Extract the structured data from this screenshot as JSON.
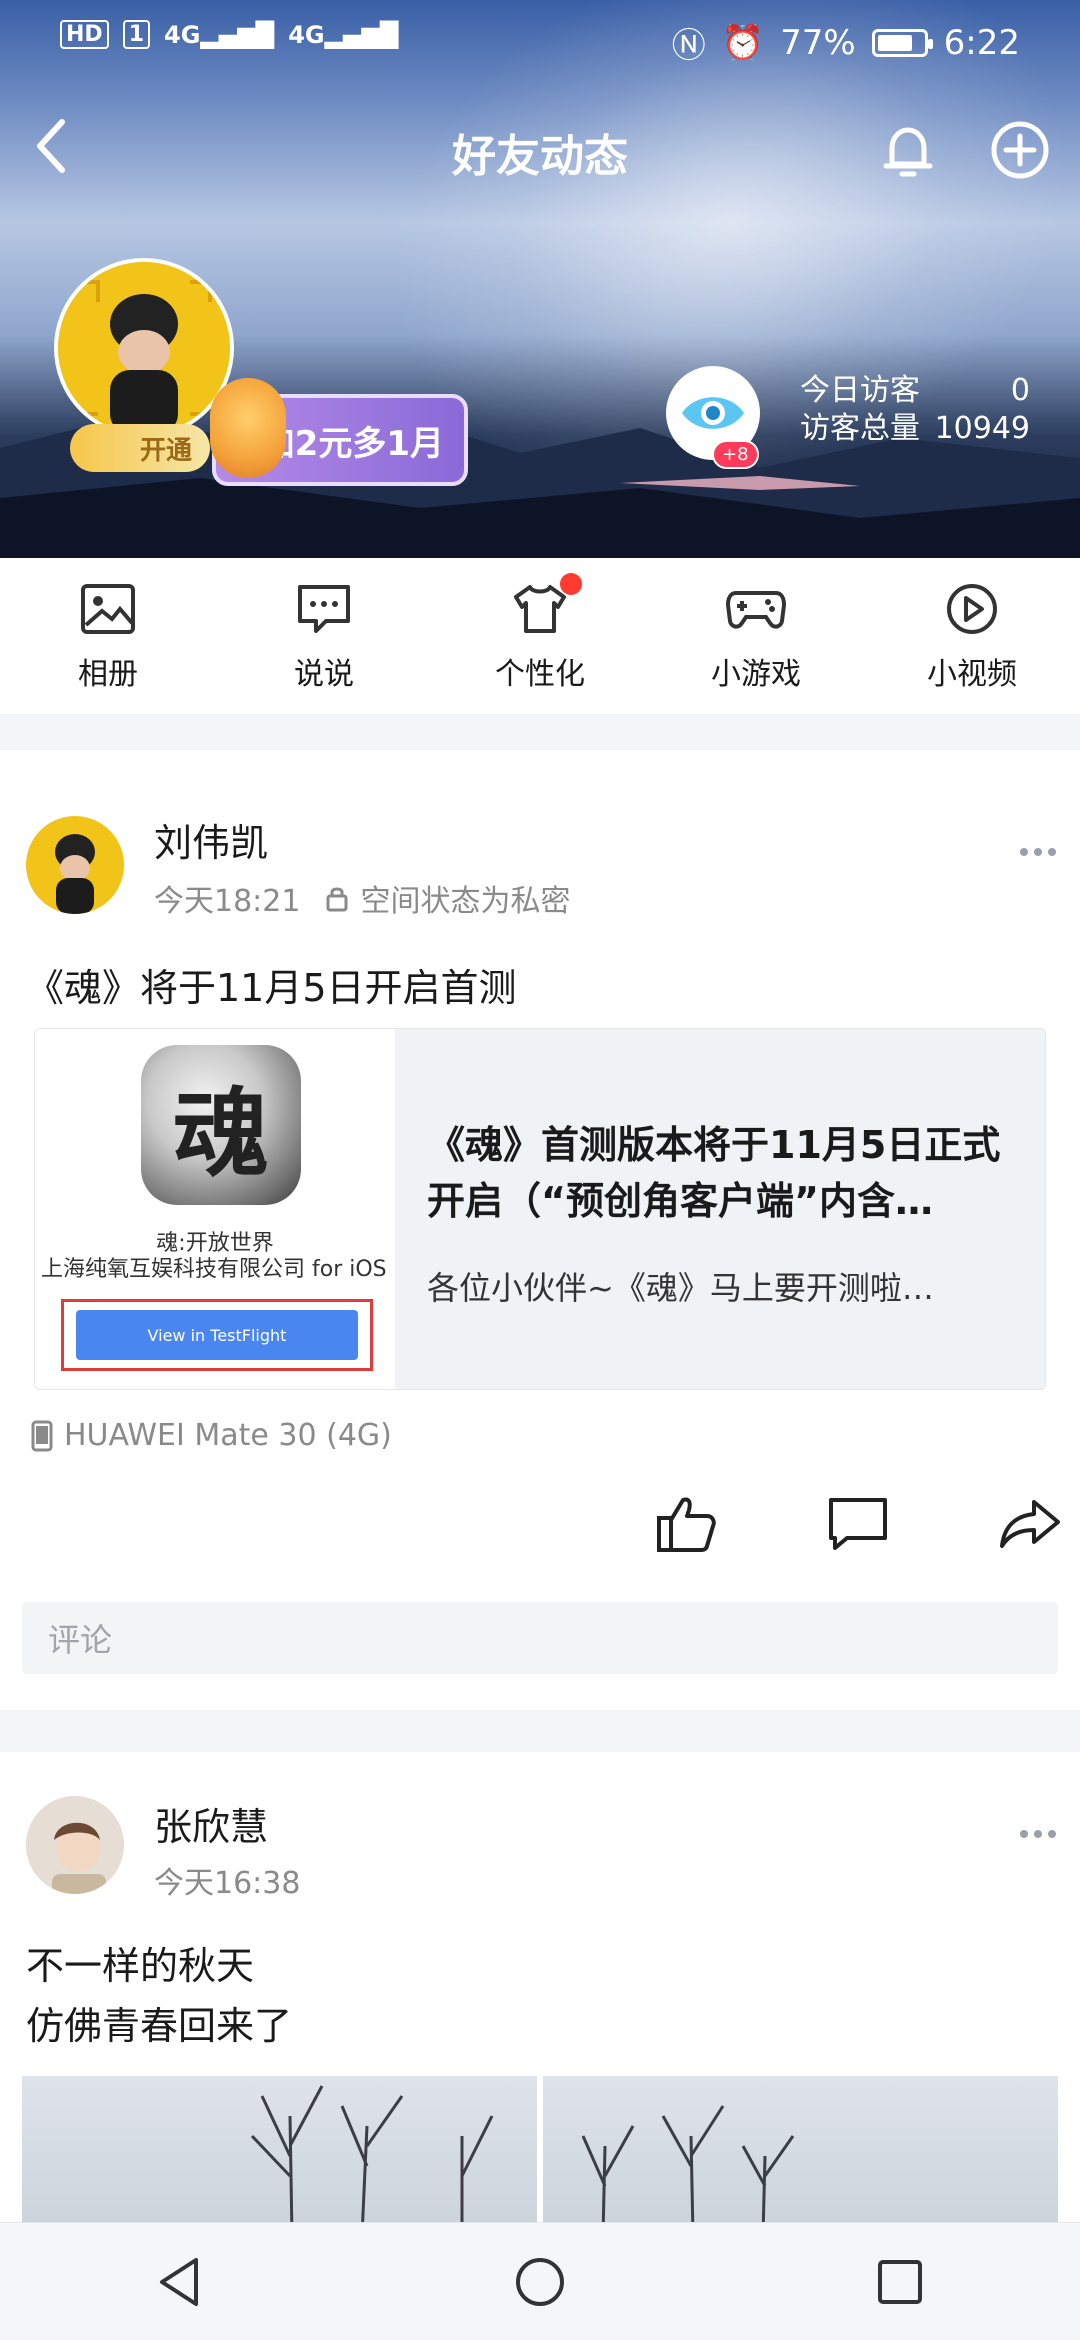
{
  "status_bar": {
    "hd": "HD",
    "sim": "1",
    "net1": "4G",
    "net2": "4G",
    "battery": "77%",
    "battery_level": 0.77,
    "time": "6:22"
  },
  "header": {
    "title": "好友动态",
    "vip_label": "开通",
    "promo_text": "加2元多1月",
    "eye_badge": "+8",
    "visitors_today_label": "今日访客",
    "visitors_today_value": "0",
    "visitors_total_label": "访客总量",
    "visitors_total_value": "10949"
  },
  "quick_menu": [
    {
      "label": "相册",
      "icon": "photo-album-icon"
    },
    {
      "label": "说说",
      "icon": "message-icon"
    },
    {
      "label": "个性化",
      "icon": "tshirt-icon"
    },
    {
      "label": "小游戏",
      "icon": "gamepad-icon"
    },
    {
      "label": "小视频",
      "icon": "video-play-icon"
    }
  ],
  "posts": [
    {
      "author": "刘伟凯",
      "time": "今天18:21",
      "privacy": "空间状态为私密",
      "text": "《魂》将于11月5日开启首测",
      "share": {
        "app_icon_glyph": "魂",
        "app_name": "魂:开放世界",
        "app_dev": "上海纯氧互娱科技有限公司 for iOS",
        "tf_button": "View in TestFlight",
        "title": "《魂》首测版本将于11月5日正式开启（“预创角客户端”内含…",
        "desc": "各位小伙伴~《魂》马上要开测啦…"
      },
      "device": "HUAWEI Mate 30 (4G)",
      "comment_placeholder": "评论"
    },
    {
      "author": "张欣慧",
      "time": "今天16:38",
      "text_line1": "不一样的秋天",
      "text_line2": "仿佛青春回来了"
    }
  ],
  "colors": {
    "accent_blue": "#4a86f0",
    "red_dot": "#ff3b30",
    "promo_purple": "#8a6ad8"
  }
}
